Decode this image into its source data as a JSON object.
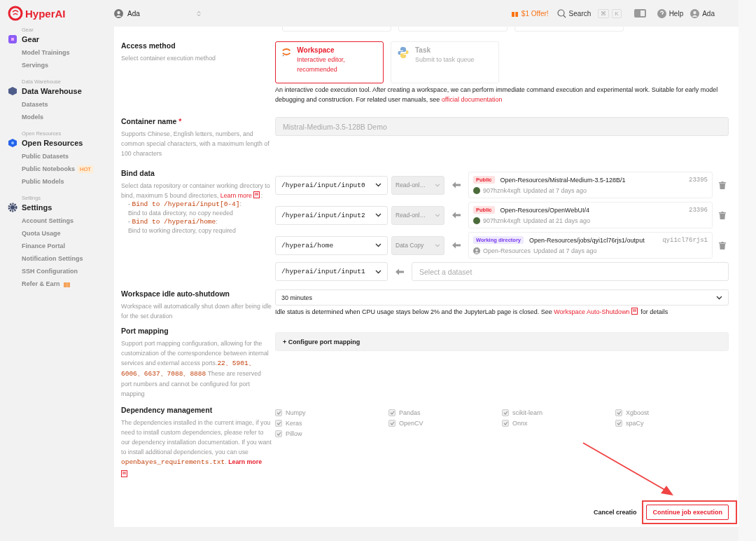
{
  "brand": "HyperAI",
  "workspace_switcher": {
    "name": "Ada"
  },
  "topbar": {
    "offer": "$1 Offer!",
    "search": "Search",
    "shortcut_keys": [
      "⌘",
      "K"
    ],
    "help": "Help",
    "user": "Ada"
  },
  "sidebar": {
    "sections": [
      {
        "caption": "Gear",
        "title": "Gear",
        "kind": "gear",
        "items": [
          {
            "label": "Model Trainings",
            "kind": "plain"
          },
          {
            "label": "Servings",
            "kind": "plain"
          }
        ]
      },
      {
        "caption": "Data Warehouse",
        "title": "Data Warehouse",
        "kind": "warehouse",
        "items": [
          {
            "label": "Datasets",
            "kind": "plain"
          },
          {
            "label": "Models",
            "kind": "plain"
          }
        ]
      },
      {
        "caption": "Open Resources",
        "title": "Open Resources",
        "kind": "resources",
        "items": [
          {
            "label": "Public Datasets",
            "kind": "plain"
          },
          {
            "label": "Public Notebooks",
            "kind": "badge",
            "badge": "HOT"
          },
          {
            "label": "Public Models",
            "kind": "plain"
          }
        ]
      },
      {
        "caption": "Settings",
        "title": "Settings",
        "kind": "settings",
        "items": [
          {
            "label": "Account Settings",
            "kind": "plain"
          },
          {
            "label": "Quota Usage",
            "kind": "plain"
          },
          {
            "label": "Finance Portal",
            "kind": "plain"
          },
          {
            "label": "Notification Settings",
            "kind": "plain"
          },
          {
            "label": "SSH Configuration",
            "kind": "plain"
          },
          {
            "label": "Refer & Earn",
            "kind": "gift"
          }
        ]
      }
    ]
  },
  "access_method": {
    "label": "Access method",
    "description": "Select container execution method",
    "options": [
      {
        "title": "Workspace",
        "subtitle": "Interactive editor, recommended",
        "kind": "jupyter",
        "selected": true
      },
      {
        "title": "Task",
        "subtitle": "Submit to task queue",
        "kind": "python",
        "selected": false
      }
    ],
    "note": "An interactive code execution tool. After creating a workspace, we can perform immediate command execution and experimental work. Suitable for early model debugging and construction. For related user manuals, see ",
    "note_link": "official documentation"
  },
  "container_name": {
    "label": "Container name",
    "required_mark": "*",
    "description": "Supports Chinese, English letters, numbers, and common special characters, with a maximum length of 100 characters",
    "value": "Mistral-Medium-3.5-128B Demo",
    "disabled": true
  },
  "bind_data": {
    "label": "Bind data",
    "description": "Select data repository or container working directory to bind, maximum 5 bound directories, ",
    "learn_more": "Learn more",
    "learn_more_end": ":",
    "rules": [
      {
        "marker": "-",
        "path": "Bind to /hyperai/input[0-4]",
        "path_end": ":",
        "description": "Bind to data directory, no copy needed"
      },
      {
        "marker": "-",
        "path": "Bind to /hyperai/home",
        "path_end": ":",
        "description": "Bind to working directory, copy required"
      }
    ],
    "bindings": [
      {
        "mount": "/hyperai/input/input0",
        "mode": "Read-onl…",
        "tag": {
          "text": "Public",
          "kind": "public"
        },
        "path": "Open-Resources/Mistral-Medium-3.5-128B/1",
        "id": "23395",
        "owner": {
          "name": "907hznk4xgft",
          "kind": "photo"
        },
        "updated": "Updated at 7 days ago"
      },
      {
        "mount": "/hyperai/input/input2",
        "mode": "Read-onl…",
        "tag": {
          "text": "Public",
          "kind": "public"
        },
        "path": "Open-Resources/OpenWebUI/4",
        "id": "23396",
        "owner": {
          "name": "907hznk4xgft",
          "kind": "photo"
        },
        "updated": "Updated at 21 days ago"
      },
      {
        "mount": "/hyperai/home",
        "mode": "Data Copy",
        "tag": {
          "text": "Working directory",
          "kind": "workdir"
        },
        "path": "Open-Resources/jobs/qyi1cl76rjs1/output",
        "id": "qyi1cl76rjs1",
        "owner": {
          "name": "Open-Resources",
          "kind": "generic"
        },
        "updated": "Updated at 7 days ago"
      }
    ],
    "new_binding": {
      "mount": "/hyperai/input/input1",
      "placeholder": "Select a dataset"
    }
  },
  "idle_shutdown": {
    "label": "Workspace idle auto-shutdown",
    "description": "Workspace will automatically shut down after being idle for the set duration",
    "value": "30 minutes",
    "note": "Idle status is determined when CPU usage stays below 2% and the JupyterLab page is closed. See ",
    "note_link": "Workspace Auto-Shutdown",
    "note_end": " for details"
  },
  "port_mapping": {
    "label": "Port mapping",
    "description_start": "Support port mapping configuration, allowing for the customization of the correspondence between internal services and external access ports.",
    "ports": "22、5901、6006、6637、7088、8888",
    "description_end": " These are reserved port numbers and cannot be configured for port mapping",
    "button": "+ Configure port mapping"
  },
  "dependencies": {
    "label": "Dependency management",
    "description": "The dependencies installed in the current image, if you need to install custom dependencies, please refer to our dependency installation documentation. If you want to install additional dependencies, you can use ",
    "file": "openbayes_requirements.txt",
    "after_file": ".",
    "learn_more": "Learn more",
    "packages": [
      {
        "name": "Numpy",
        "checked": true
      },
      {
        "name": "Pandas",
        "checked": true
      },
      {
        "name": "scikit-learn",
        "checked": true
      },
      {
        "name": "Xgboost",
        "checked": true
      },
      {
        "name": "Keras",
        "checked": true
      },
      {
        "name": "OpenCV",
        "checked": true
      },
      {
        "name": "Onnx",
        "checked": true
      },
      {
        "name": "spaCy",
        "checked": true
      },
      {
        "name": "Pillow",
        "checked": true
      }
    ]
  },
  "footer": {
    "cancel": "Cancel creatio",
    "submit": "Continue job execution"
  }
}
